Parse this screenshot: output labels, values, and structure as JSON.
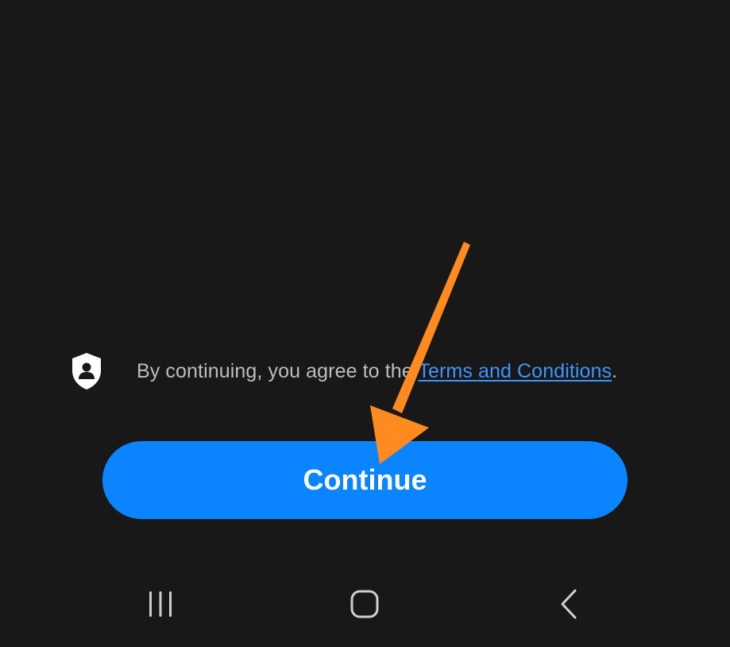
{
  "terms": {
    "prefix": "By continuing, you agree to the ",
    "link_label": "Terms and Conditions",
    "suffix": ".",
    "icon": "shield-person-icon"
  },
  "primary_action": {
    "label": "Continue",
    "color": "#0a84ff"
  },
  "annotation": {
    "type": "arrow",
    "color": "#ff8a1f",
    "points_to": "continue-button"
  },
  "nav_bar": {
    "items": [
      {
        "name": "recent-apps",
        "icon": "recent-apps-icon"
      },
      {
        "name": "home",
        "icon": "home-icon"
      },
      {
        "name": "back",
        "icon": "back-icon"
      }
    ]
  },
  "theme": {
    "background": "#181818",
    "text_secondary": "#bdbdbd",
    "link": "#3f95ff"
  }
}
